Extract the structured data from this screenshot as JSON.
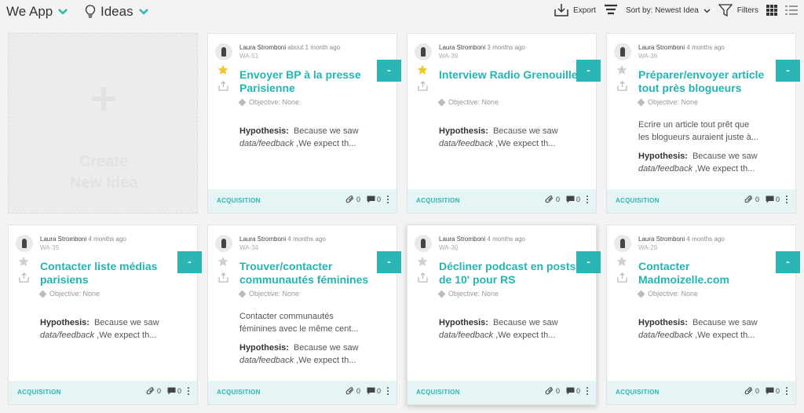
{
  "header": {
    "app_name": "We App",
    "section": "Ideas",
    "export_label": "Export",
    "sort_label": "Sort by: Newest Idea",
    "filters_label": "Filters"
  },
  "new_idea": {
    "label": "Create\nNew Idea"
  },
  "colors": {
    "accent": "#2bb5b5",
    "footer_bg": "#e5f4f4",
    "star": "#f3c623"
  },
  "cards": [
    {
      "author": "Laura Stromboni",
      "time": "about 1 month ago",
      "code": "WA-51",
      "title": "Envoyer BP à la presse Parisienne",
      "starred": true,
      "objective": "Objective: None",
      "description": [
        "",
        ""
      ],
      "hyp_label": "Hypothesis:",
      "hyp_text": "Because we saw",
      "hyp_italic": "data/feedback",
      "hyp_rest": " ,We expect th...",
      "tag": "ACQUISITION",
      "attachments": "0",
      "comments": "0"
    },
    {
      "author": "Laura Stromboni",
      "time": "3 months ago",
      "code": "WA-39",
      "title": "Interview Radio Grenouille",
      "starred": true,
      "objective": "Objective: None",
      "description": [
        "",
        ""
      ],
      "hyp_label": "Hypothesis:",
      "hyp_text": "Because we saw",
      "hyp_italic": "data/feedback",
      "hyp_rest": " ,We expect th...",
      "tag": "ACQUISITION",
      "attachments": "0",
      "comments": "0"
    },
    {
      "author": "Laura Stromboni",
      "time": "4 months ago",
      "code": "WA-36",
      "title": "Préparer/envoyer article tout près blogueurs",
      "starred": false,
      "objective": "Objective: None",
      "description": [
        "Ecrire un article tout prêt que",
        "les blogueurs auraient juste à..."
      ],
      "hyp_label": "Hypothesis:",
      "hyp_text": "Because we saw",
      "hyp_italic": "data/feedback",
      "hyp_rest": " ,We expect th...",
      "tag": "ACQUISITION",
      "attachments": "0",
      "comments": "0"
    },
    {
      "author": "Laura Stromboni",
      "time": "4 months ago",
      "code": "WA-35",
      "title": "Contacter liste médias parisiens",
      "starred": false,
      "objective": "Objective: None",
      "description": [
        "",
        ""
      ],
      "hyp_label": "Hypothesis:",
      "hyp_text": "Because we saw",
      "hyp_italic": "data/feedback",
      "hyp_rest": " ,We expect th...",
      "tag": "ACQUISITION",
      "attachments": "0",
      "comments": "0"
    },
    {
      "author": "Laura Stromboni",
      "time": "4 months ago",
      "code": "WA-34",
      "title": "Trouver/contacter communautés féminines",
      "starred": false,
      "objective": "Objective: None",
      "description": [
        "Contacter communautés",
        "féminines avec le même cent..."
      ],
      "hyp_label": "Hypothesis:",
      "hyp_text": "Because we saw",
      "hyp_italic": "data/feedback",
      "hyp_rest": " ,We expect th...",
      "tag": "ACQUISITION",
      "attachments": "0",
      "comments": "0"
    },
    {
      "author": "Laura Stromboni",
      "time": "4 months ago",
      "code": "WA-30",
      "title": "Décliner podcast en posts de 10' pour RS",
      "starred": false,
      "objective": "Objective: None",
      "description": [
        "",
        ""
      ],
      "hyp_label": "Hypothesis:",
      "hyp_text": "Because we saw",
      "hyp_italic": "data/feedback",
      "hyp_rest": " ,We expect th...",
      "tag": "ACQUISITION",
      "attachments": "0",
      "comments": "0"
    },
    {
      "author": "Laura Stromboni",
      "time": "4 months ago",
      "code": "WA-29",
      "title": "Contacter Madmoizelle.com",
      "starred": false,
      "objective": "Objective: None",
      "description": [
        "",
        ""
      ],
      "hyp_label": "Hypothesis:",
      "hyp_text": "Because we saw",
      "hyp_italic": "data/feedback",
      "hyp_rest": " ,We expect th...",
      "tag": "ACQUISITION",
      "attachments": "0",
      "comments": "0"
    }
  ]
}
